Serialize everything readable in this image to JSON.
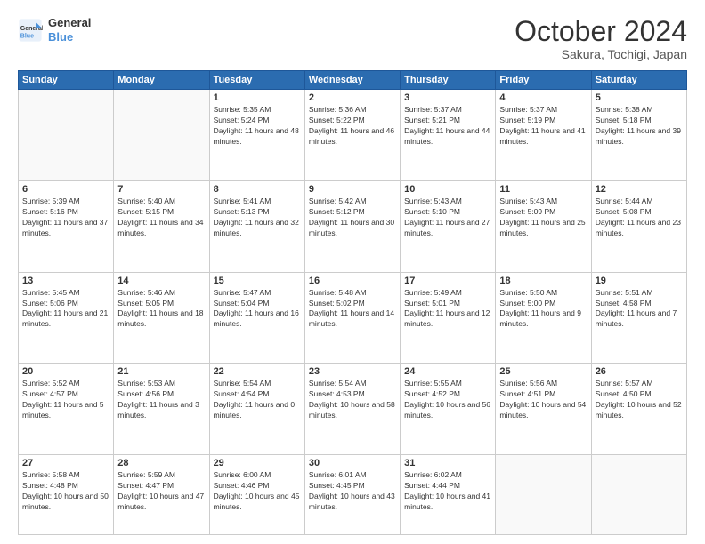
{
  "header": {
    "logo_line1": "General",
    "logo_line2": "Blue",
    "month": "October 2024",
    "location": "Sakura, Tochigi, Japan"
  },
  "weekdays": [
    "Sunday",
    "Monday",
    "Tuesday",
    "Wednesday",
    "Thursday",
    "Friday",
    "Saturday"
  ],
  "weeks": [
    [
      {
        "day": "",
        "info": ""
      },
      {
        "day": "",
        "info": ""
      },
      {
        "day": "1",
        "info": "Sunrise: 5:35 AM\nSunset: 5:24 PM\nDaylight: 11 hours and 48 minutes."
      },
      {
        "day": "2",
        "info": "Sunrise: 5:36 AM\nSunset: 5:22 PM\nDaylight: 11 hours and 46 minutes."
      },
      {
        "day": "3",
        "info": "Sunrise: 5:37 AM\nSunset: 5:21 PM\nDaylight: 11 hours and 44 minutes."
      },
      {
        "day": "4",
        "info": "Sunrise: 5:37 AM\nSunset: 5:19 PM\nDaylight: 11 hours and 41 minutes."
      },
      {
        "day": "5",
        "info": "Sunrise: 5:38 AM\nSunset: 5:18 PM\nDaylight: 11 hours and 39 minutes."
      }
    ],
    [
      {
        "day": "6",
        "info": "Sunrise: 5:39 AM\nSunset: 5:16 PM\nDaylight: 11 hours and 37 minutes."
      },
      {
        "day": "7",
        "info": "Sunrise: 5:40 AM\nSunset: 5:15 PM\nDaylight: 11 hours and 34 minutes."
      },
      {
        "day": "8",
        "info": "Sunrise: 5:41 AM\nSunset: 5:13 PM\nDaylight: 11 hours and 32 minutes."
      },
      {
        "day": "9",
        "info": "Sunrise: 5:42 AM\nSunset: 5:12 PM\nDaylight: 11 hours and 30 minutes."
      },
      {
        "day": "10",
        "info": "Sunrise: 5:43 AM\nSunset: 5:10 PM\nDaylight: 11 hours and 27 minutes."
      },
      {
        "day": "11",
        "info": "Sunrise: 5:43 AM\nSunset: 5:09 PM\nDaylight: 11 hours and 25 minutes."
      },
      {
        "day": "12",
        "info": "Sunrise: 5:44 AM\nSunset: 5:08 PM\nDaylight: 11 hours and 23 minutes."
      }
    ],
    [
      {
        "day": "13",
        "info": "Sunrise: 5:45 AM\nSunset: 5:06 PM\nDaylight: 11 hours and 21 minutes."
      },
      {
        "day": "14",
        "info": "Sunrise: 5:46 AM\nSunset: 5:05 PM\nDaylight: 11 hours and 18 minutes."
      },
      {
        "day": "15",
        "info": "Sunrise: 5:47 AM\nSunset: 5:04 PM\nDaylight: 11 hours and 16 minutes."
      },
      {
        "day": "16",
        "info": "Sunrise: 5:48 AM\nSunset: 5:02 PM\nDaylight: 11 hours and 14 minutes."
      },
      {
        "day": "17",
        "info": "Sunrise: 5:49 AM\nSunset: 5:01 PM\nDaylight: 11 hours and 12 minutes."
      },
      {
        "day": "18",
        "info": "Sunrise: 5:50 AM\nSunset: 5:00 PM\nDaylight: 11 hours and 9 minutes."
      },
      {
        "day": "19",
        "info": "Sunrise: 5:51 AM\nSunset: 4:58 PM\nDaylight: 11 hours and 7 minutes."
      }
    ],
    [
      {
        "day": "20",
        "info": "Sunrise: 5:52 AM\nSunset: 4:57 PM\nDaylight: 11 hours and 5 minutes."
      },
      {
        "day": "21",
        "info": "Sunrise: 5:53 AM\nSunset: 4:56 PM\nDaylight: 11 hours and 3 minutes."
      },
      {
        "day": "22",
        "info": "Sunrise: 5:54 AM\nSunset: 4:54 PM\nDaylight: 11 hours and 0 minutes."
      },
      {
        "day": "23",
        "info": "Sunrise: 5:54 AM\nSunset: 4:53 PM\nDaylight: 10 hours and 58 minutes."
      },
      {
        "day": "24",
        "info": "Sunrise: 5:55 AM\nSunset: 4:52 PM\nDaylight: 10 hours and 56 minutes."
      },
      {
        "day": "25",
        "info": "Sunrise: 5:56 AM\nSunset: 4:51 PM\nDaylight: 10 hours and 54 minutes."
      },
      {
        "day": "26",
        "info": "Sunrise: 5:57 AM\nSunset: 4:50 PM\nDaylight: 10 hours and 52 minutes."
      }
    ],
    [
      {
        "day": "27",
        "info": "Sunrise: 5:58 AM\nSunset: 4:48 PM\nDaylight: 10 hours and 50 minutes."
      },
      {
        "day": "28",
        "info": "Sunrise: 5:59 AM\nSunset: 4:47 PM\nDaylight: 10 hours and 47 minutes."
      },
      {
        "day": "29",
        "info": "Sunrise: 6:00 AM\nSunset: 4:46 PM\nDaylight: 10 hours and 45 minutes."
      },
      {
        "day": "30",
        "info": "Sunrise: 6:01 AM\nSunset: 4:45 PM\nDaylight: 10 hours and 43 minutes."
      },
      {
        "day": "31",
        "info": "Sunrise: 6:02 AM\nSunset: 4:44 PM\nDaylight: 10 hours and 41 minutes."
      },
      {
        "day": "",
        "info": ""
      },
      {
        "day": "",
        "info": ""
      }
    ]
  ]
}
